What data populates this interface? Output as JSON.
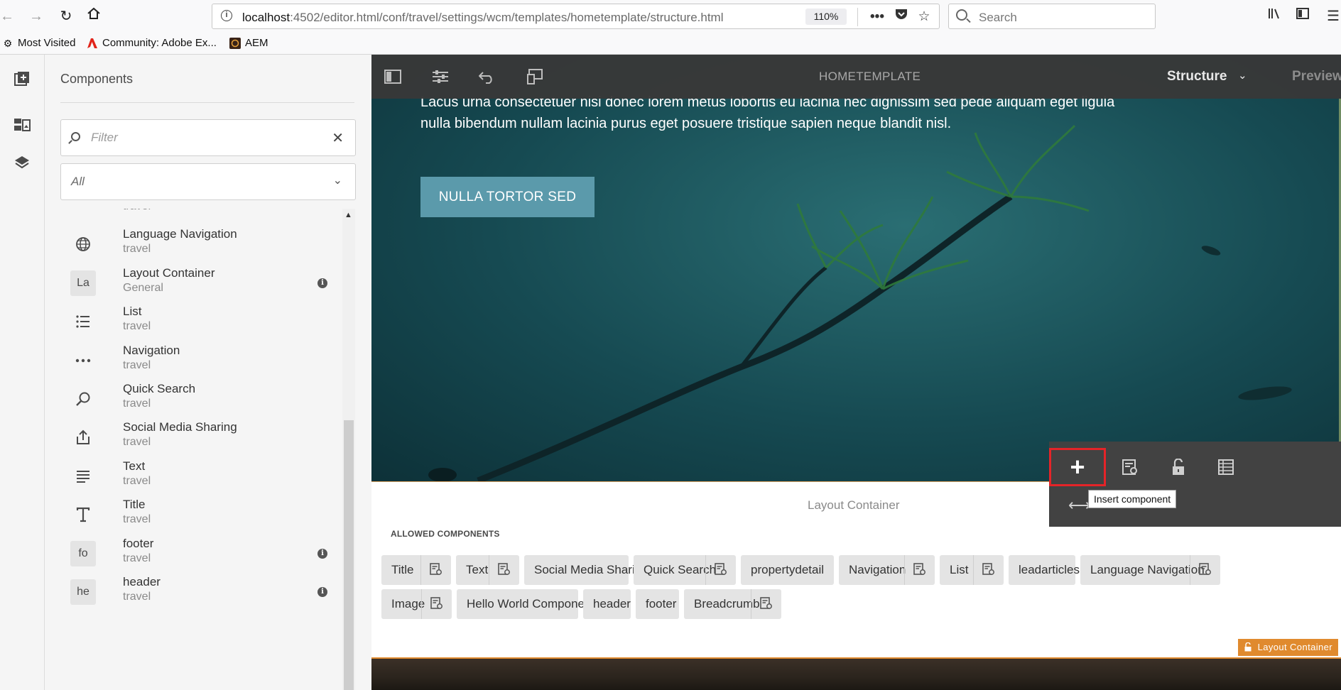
{
  "browser": {
    "url_host": "localhost",
    "url_path": ":4502/editor.html/conf/travel/settings/wcm/templates/hometemplate/structure.html",
    "zoom": "110%",
    "search_placeholder": "Search",
    "bookmarks": [
      {
        "label": "Most Visited",
        "icon": "gear-icon"
      },
      {
        "label": "Community: Adobe Ex...",
        "icon": "adobe-icon"
      },
      {
        "label": "AEM",
        "icon": "aem-icon"
      }
    ]
  },
  "panel": {
    "title": "Components",
    "filter_placeholder": "Filter",
    "group_selected": "All",
    "partial_item_group": "travel",
    "items": [
      {
        "name": "Language Navigation",
        "group": "travel",
        "icon": "globe-icon",
        "abbr": "",
        "info": false
      },
      {
        "name": "Layout Container",
        "group": "General",
        "icon": "abbr-icon",
        "abbr": "La",
        "info": true
      },
      {
        "name": "List",
        "group": "travel",
        "icon": "list-icon",
        "abbr": "",
        "info": false
      },
      {
        "name": "Navigation",
        "group": "travel",
        "icon": "more-icon",
        "abbr": "",
        "info": false
      },
      {
        "name": "Quick Search",
        "group": "travel",
        "icon": "search-icon",
        "abbr": "",
        "info": false
      },
      {
        "name": "Social Media Sharing",
        "group": "travel",
        "icon": "share-icon",
        "abbr": "",
        "info": false
      },
      {
        "name": "Text",
        "group": "travel",
        "icon": "text-icon",
        "abbr": "",
        "info": false
      },
      {
        "name": "Title",
        "group": "travel",
        "icon": "title-icon",
        "abbr": "",
        "info": false
      },
      {
        "name": "footer",
        "group": "travel",
        "icon": "abbr-icon",
        "abbr": "fo",
        "info": true
      },
      {
        "name": "header",
        "group": "travel",
        "icon": "abbr-icon",
        "abbr": "he",
        "info": true
      }
    ]
  },
  "editor": {
    "template_title": "HOMETEMPLATE",
    "mode": "Structure",
    "preview_label": "Preview",
    "hero_text": "Lacus urna consectetuer nisi donec lorem metus lobortis eu lacinia nec dignissim sed pede aliquam eget ligula nulla bibendum nullam lacinia purus eget posuere tristique sapien neque blandit nisl.",
    "hero_button": "NULLA TORTOR SED",
    "container_label": "Layout Container",
    "allowed_heading": "ALLOWED COMPONENTS",
    "container_tag": "Layout Container",
    "tooltip": "Insert component",
    "allowed_components": [
      {
        "label": "Title",
        "policy": true
      },
      {
        "label": "Text",
        "policy": true
      },
      {
        "label": "Social Media Sharing",
        "policy": false
      },
      {
        "label": "Quick Search",
        "policy": true
      },
      {
        "label": "propertydetail",
        "policy": false
      },
      {
        "label": "Navigation",
        "policy": true
      },
      {
        "label": "List",
        "policy": true
      },
      {
        "label": "leadarticles",
        "policy": false
      },
      {
        "label": "Language Navigation",
        "policy": true
      },
      {
        "label": "Image",
        "policy": true
      },
      {
        "label": "Hello World Component",
        "policy": false
      },
      {
        "label": "header",
        "policy": false
      },
      {
        "label": "footer",
        "policy": false
      },
      {
        "label": "Breadcrumb",
        "policy": true
      }
    ]
  },
  "colors": {
    "accent_orange": "#e08a2e",
    "highlight_red": "#e52428",
    "hero_button": "#5b9aab"
  }
}
